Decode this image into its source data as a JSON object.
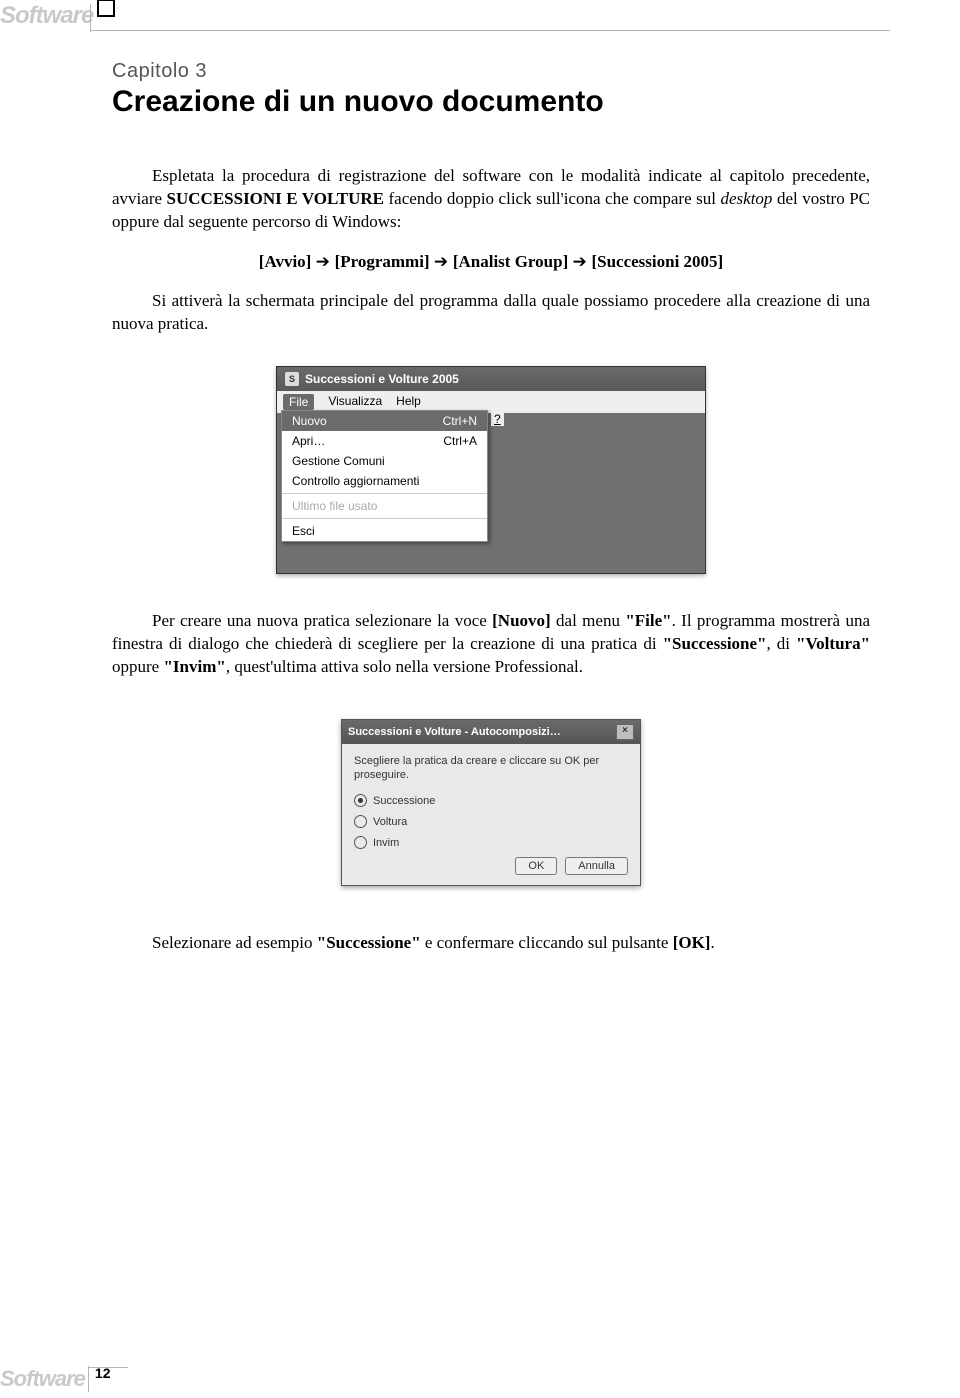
{
  "header": {
    "brand": "Software"
  },
  "chapter_label": "Capitolo 3",
  "title": "Creazione di un nuovo documento",
  "para1_a": "Espletata la procedura di registrazione del software con le modalità indicate al capitolo precedente, avviare ",
  "para1_b": "SUCCESSIONI E VOLTURE",
  "para1_c": " facendo doppio click sull'icona che compare sul ",
  "para1_d": "desktop",
  "para1_e": " del vostro PC oppure dal seguente percorso di Windows:",
  "path": {
    "a": "[Avvio]",
    "b": "[Programmi]",
    "c": "[Analist Group]",
    "d": "[Successioni 2005]"
  },
  "para2": "Si attiverà la schermata principale del programma dalla quale possiamo procedere alla creazione di una nuova pratica.",
  "screenshot1": {
    "title": "Successioni e Volture 2005",
    "icon_letter": "S",
    "menus": {
      "file": "File",
      "visualizza": "Visualizza",
      "help": "Help"
    },
    "file_menu": {
      "nuovo": "Nuovo",
      "nuovo_sc": "Ctrl+N",
      "apri": "Apri…",
      "apri_sc": "Ctrl+A",
      "gestione": "Gestione Comuni",
      "controllo": "Controllo aggiornamenti",
      "ultimo": "Ultimo file usato",
      "esci": "Esci"
    },
    "question": "?"
  },
  "para3_a": "Per creare una nuova pratica selezionare la voce ",
  "para3_b": "[Nuovo]",
  "para3_c": " dal menu ",
  "para3_d": "\"File\"",
  "para3_e": ". Il programma mostrerà una finestra di dialogo che chiederà di scegliere per la creazione di una pratica di ",
  "para3_f": "\"Successione\"",
  "para3_g": ", di ",
  "para3_h": "\"Voltura\"",
  "para3_i": " oppure ",
  "para3_j": "\"Invim\"",
  "para3_k": ", quest'ultima attiva solo nella versione Professional.",
  "screenshot2": {
    "title": "Successioni e Volture - Autocomposizi…",
    "instr": "Scegliere la pratica da creare e cliccare su OK per proseguire.",
    "opts": {
      "successione": "Successione",
      "voltura": "Voltura",
      "invim": "Invim"
    },
    "ok": "OK",
    "annulla": "Annulla"
  },
  "para4_a": "Selezionare ad esempio ",
  "para4_b": "\"Successione\"",
  "para4_c": " e confermare cliccando sul pulsante ",
  "para4_d": "[OK]",
  "para4_e": ".",
  "page_number": "12"
}
